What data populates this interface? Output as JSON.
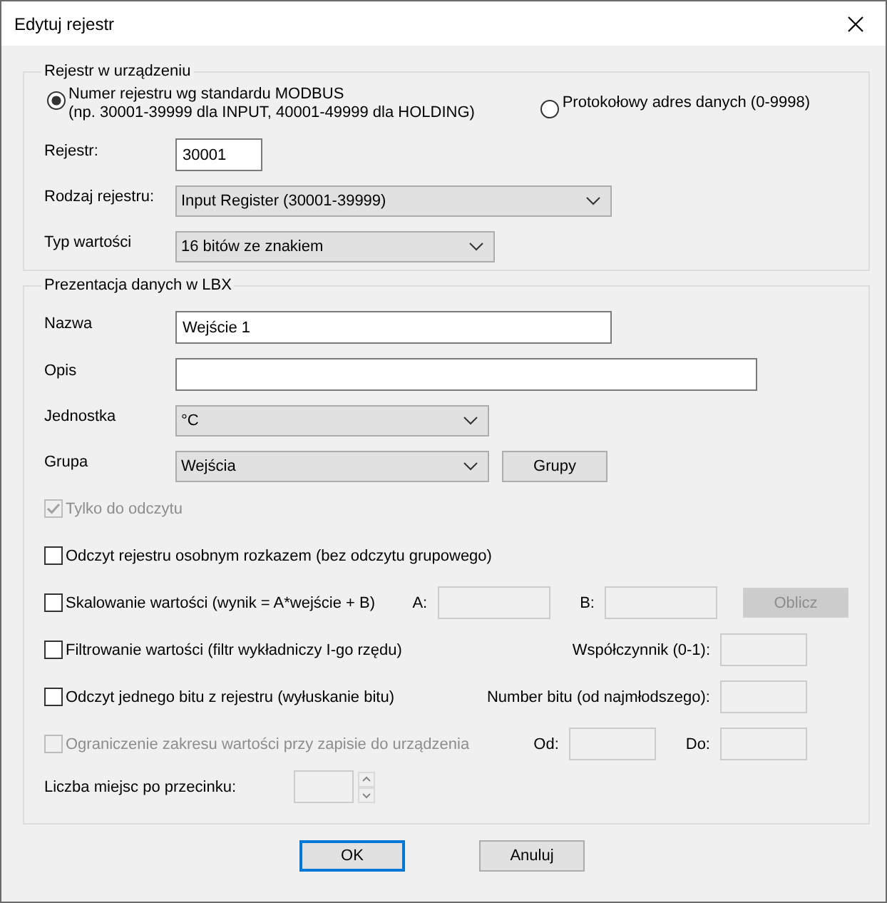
{
  "window": {
    "title": "Edytuj rejestr"
  },
  "device_group": {
    "title": "Rejestr w urządzeniu",
    "address_modes": [
      {
        "label": "Numer rejestru wg standardu MODBUS",
        "note": "(np. 30001-39999 dla INPUT, 40001-49999 dla HOLDING)",
        "selected": true
      },
      {
        "label": "Protokołowy adres danych (0-9998)",
        "selected": false
      }
    ],
    "fields": [
      {
        "kind": "text",
        "label": "Rejestr:",
        "value": "30001"
      },
      {
        "kind": "select",
        "label": "Rodzaj rejestru:",
        "value": "Input Register (30001-39999)"
      },
      {
        "kind": "select",
        "label": "Typ wartości",
        "value": "16 bitów ze znakiem"
      }
    ]
  },
  "presentation_group": {
    "title": "Prezentacja danych w LBX",
    "fields": [
      {
        "kind": "text",
        "label": "Nazwa",
        "value": "Wejście 1"
      },
      {
        "kind": "text",
        "label": "Opis"
      },
      {
        "kind": "select",
        "label": "Jednostka",
        "value": "°C"
      },
      {
        "kind": "select",
        "label": "Grupa",
        "value": "Wejścia",
        "button": "Grupy"
      }
    ],
    "options": [
      {
        "label": "Tylko do odczytu",
        "checked": true,
        "disabled": true
      },
      {
        "label": "Odczyt rejestru osobnym rozkazem (bez odczytu grupowego)",
        "checked": false,
        "disabled": false
      },
      {
        "label": "Skalowanie wartości (wynik = A*wejście + B)",
        "checked": false,
        "disabled": false,
        "params": [
          {
            "label": "A:"
          },
          {
            "label": "B:"
          }
        ],
        "action": {
          "label": "Oblicz",
          "disabled": true
        }
      },
      {
        "label": "Filtrowanie wartości (filtr wykładniczy I-go rzędu)",
        "checked": false,
        "disabled": false,
        "params": [
          {
            "label": "Współczynnik (0-1):"
          }
        ]
      },
      {
        "label": "Odczyt jednego bitu z rejestru (wyłuskanie bitu)",
        "checked": false,
        "disabled": false,
        "params": [
          {
            "label": "Number bitu (od najmłodszego):"
          }
        ]
      },
      {
        "label": "Ograniczenie zakresu wartości przy zapisie do urządzenia",
        "checked": false,
        "disabled": true,
        "params": [
          {
            "label": "Od:"
          },
          {
            "label": "Do:"
          }
        ]
      }
    ],
    "decimals": {
      "label": "Liczba miejsc po przecinku:"
    }
  },
  "buttons": [
    {
      "label": "OK",
      "focused": true
    },
    {
      "label": "Anuluj",
      "focused": false
    }
  ]
}
